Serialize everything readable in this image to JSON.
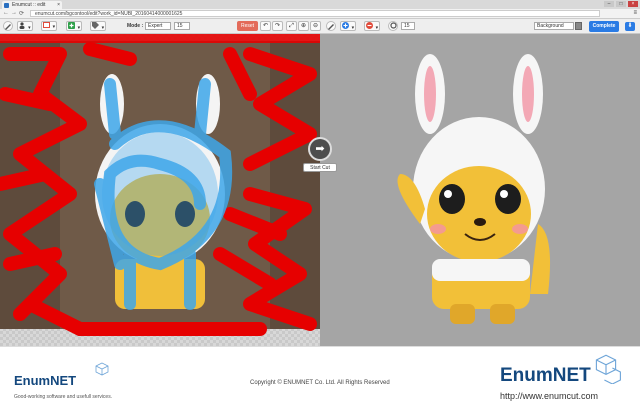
{
  "browser": {
    "tab_title": "Enumcut :: edit",
    "url": "enumcut.com/bgcontool/edit?work_id=NUBI_20160414000001625",
    "close_glyph": "×",
    "back_glyph": "←",
    "forward_glyph": "→",
    "reload_glyph": "⟳",
    "menu_glyph": "≡",
    "min_glyph": "–",
    "max_glyph": "□",
    "winclose_glyph": "×"
  },
  "toolbar": {
    "mode_label": "Mode :",
    "mode_value": "Expert",
    "brush_size": "15",
    "right_brush_size": "15",
    "reset_label": "Reset",
    "background_label": "Background",
    "complete_label": "Complete",
    "help_glyph": "⬇",
    "icons": [
      "brush-icon",
      "person-icon",
      "layer-icon",
      "add-icon",
      "tag-icon",
      "undo-icon",
      "redo-icon",
      "zoom-fit-icon",
      "zoom-in-icon",
      "zoom-out-icon",
      "plus-circle-icon",
      "minus-circle-icon",
      "brush-right-icon",
      "settings-icon"
    ]
  },
  "editor": {
    "start_cut_label": "Start Cut",
    "start_cut_glyph": "➡"
  },
  "footer": {
    "logo_left": "EnumNET",
    "tagline": "Good-working software and usefull services.",
    "copyright": "Copyright © ENUMNET Co. Ltd. All Rights Reserved",
    "logo_right": "EnumNET",
    "website": "http://www.enumcut.com"
  },
  "colors": {
    "foreground_mark": "#e60000",
    "background_mark": "#3ea7ea",
    "result_bg": "#a5a5a5",
    "accent": "#2a7be4",
    "reset": "#e36b5a",
    "brand": "#14487e"
  }
}
